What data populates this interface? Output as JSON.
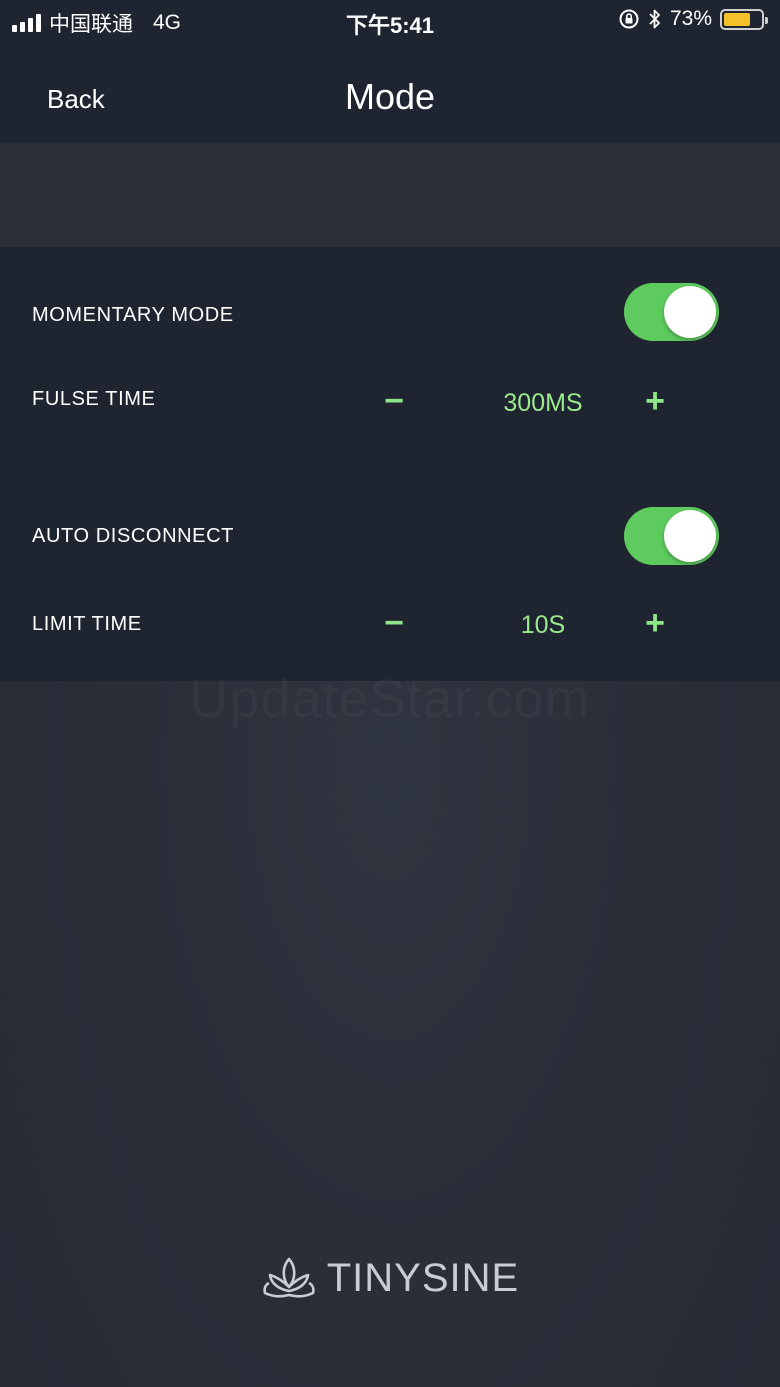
{
  "status_bar": {
    "carrier": "中国联通",
    "network": "4G",
    "time": "下午5:41",
    "battery_percent": "73%",
    "battery_level": 0.73,
    "battery_color": "#f5c12b"
  },
  "nav": {
    "back_label": "Back",
    "title": "Mode"
  },
  "settings": {
    "momentary_mode": {
      "label": "MOMENTARY MODE",
      "enabled": true
    },
    "fulse_time": {
      "label": "FULSE TIME",
      "decrement": "−",
      "value": "300MS",
      "increment": "+"
    },
    "auto_disconnect": {
      "label": "AUTO DISCONNECT",
      "enabled": true
    },
    "limit_time": {
      "label": "LIMIT TIME",
      "decrement": "−",
      "value": "10S",
      "increment": "+"
    }
  },
  "watermark": "UpdateStar.com",
  "brand": {
    "name": "TINYSINE"
  },
  "colors": {
    "toggle_on": "#5ecb5f",
    "accent_text": "#9be98d",
    "panel_bg": "#1f2431"
  }
}
